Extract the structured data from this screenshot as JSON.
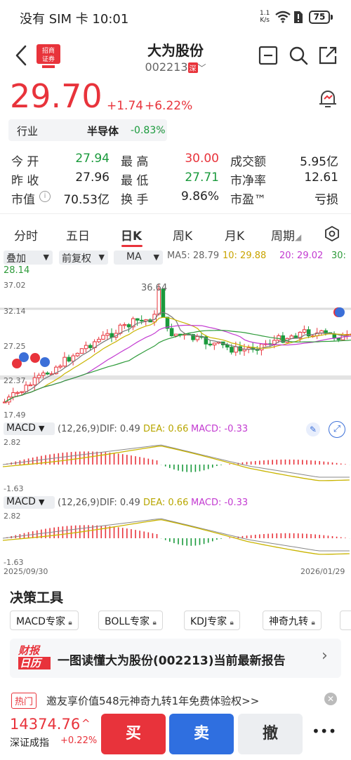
{
  "status_bar": {
    "carrier": "没有 SIM 卡 10:01",
    "net_speed_top": "1.1",
    "net_speed_bottom": "K/s",
    "battery": "75"
  },
  "header": {
    "title": "大为股份",
    "code": "002213",
    "market_tag": "深"
  },
  "quote": {
    "price": "29.70",
    "change": "+1.74",
    "change_pct": "+6.22%"
  },
  "industry": {
    "label": "行业",
    "name": "半导体",
    "pct": "-0.83%"
  },
  "stats": [
    [
      {
        "label": "今  开",
        "value": "27.94"
      },
      {
        "label": "最  高",
        "value": "30.00"
      },
      {
        "label": "成交额",
        "value": "5.95亿"
      }
    ],
    [
      {
        "label": "昨  收",
        "value": "27.96"
      },
      {
        "label": "最  低",
        "value": "27.71"
      },
      {
        "label": "市净率",
        "value": "12.61"
      }
    ],
    [
      {
        "label": "市值",
        "value": "70.53亿"
      },
      {
        "label": "换  手",
        "value": "9.86%"
      },
      {
        "label": "市盈™",
        "value": "亏损"
      }
    ]
  ],
  "tabs": [
    "分时",
    "五日",
    "日K",
    "周K",
    "月K",
    "周期"
  ],
  "controls": {
    "overlay": "叠加",
    "adjust": "前复权",
    "indicator": "MA"
  },
  "ma": {
    "ma5": "MA5: 28.79",
    "ma10": "10: 29.88",
    "ma20": "20: 29.02",
    "ma30_label": "30:",
    "ma30": "28.14"
  },
  "price_axis": {
    "high": "37.02",
    "mid": "32.14",
    "mid2": "27.25",
    "mid3": "22.37",
    "low": "17.49",
    "peak_label": "36.64"
  },
  "macd1": {
    "name": "MACD",
    "params": "(12,26,9)",
    "dif": "DIF: 0.49",
    "dea": "DEA: 0.66",
    "macd": "MACD: -0.33",
    "top": "2.82",
    "bottom": "-1.63"
  },
  "macd2": {
    "name": "MACD",
    "params": "(12,26,9)",
    "dif": "DIF: 0.49",
    "dea": "DEA: 0.66",
    "macd": "MACD: -0.33",
    "top": "2.82",
    "bottom": "-1.63"
  },
  "dates": {
    "start": "2025/09/30",
    "end": "2026/01/29"
  },
  "tools": {
    "title": "决策工具",
    "items": [
      "MACD专家",
      "BOLL专家",
      "KDJ专家",
      "神奇九转"
    ]
  },
  "report": {
    "logo_top": "财报",
    "logo_bottom": "日历",
    "text": "一图读懂大为股份(002213)当前最新报告"
  },
  "hot": {
    "tag": "热门",
    "text": "邀友享价值548元神奇九转1年免费体验权>>"
  },
  "index": {
    "value": "14374.76",
    "name": "深证成指",
    "pct": "+0.22%"
  },
  "actions": {
    "buy": "买",
    "sell": "卖",
    "cancel": "撤",
    "more": "•••"
  },
  "colors": {
    "up": "#e8333b",
    "down": "#1a9a3c",
    "buy": "#e8333b",
    "sell": "#2f6fe0"
  }
}
